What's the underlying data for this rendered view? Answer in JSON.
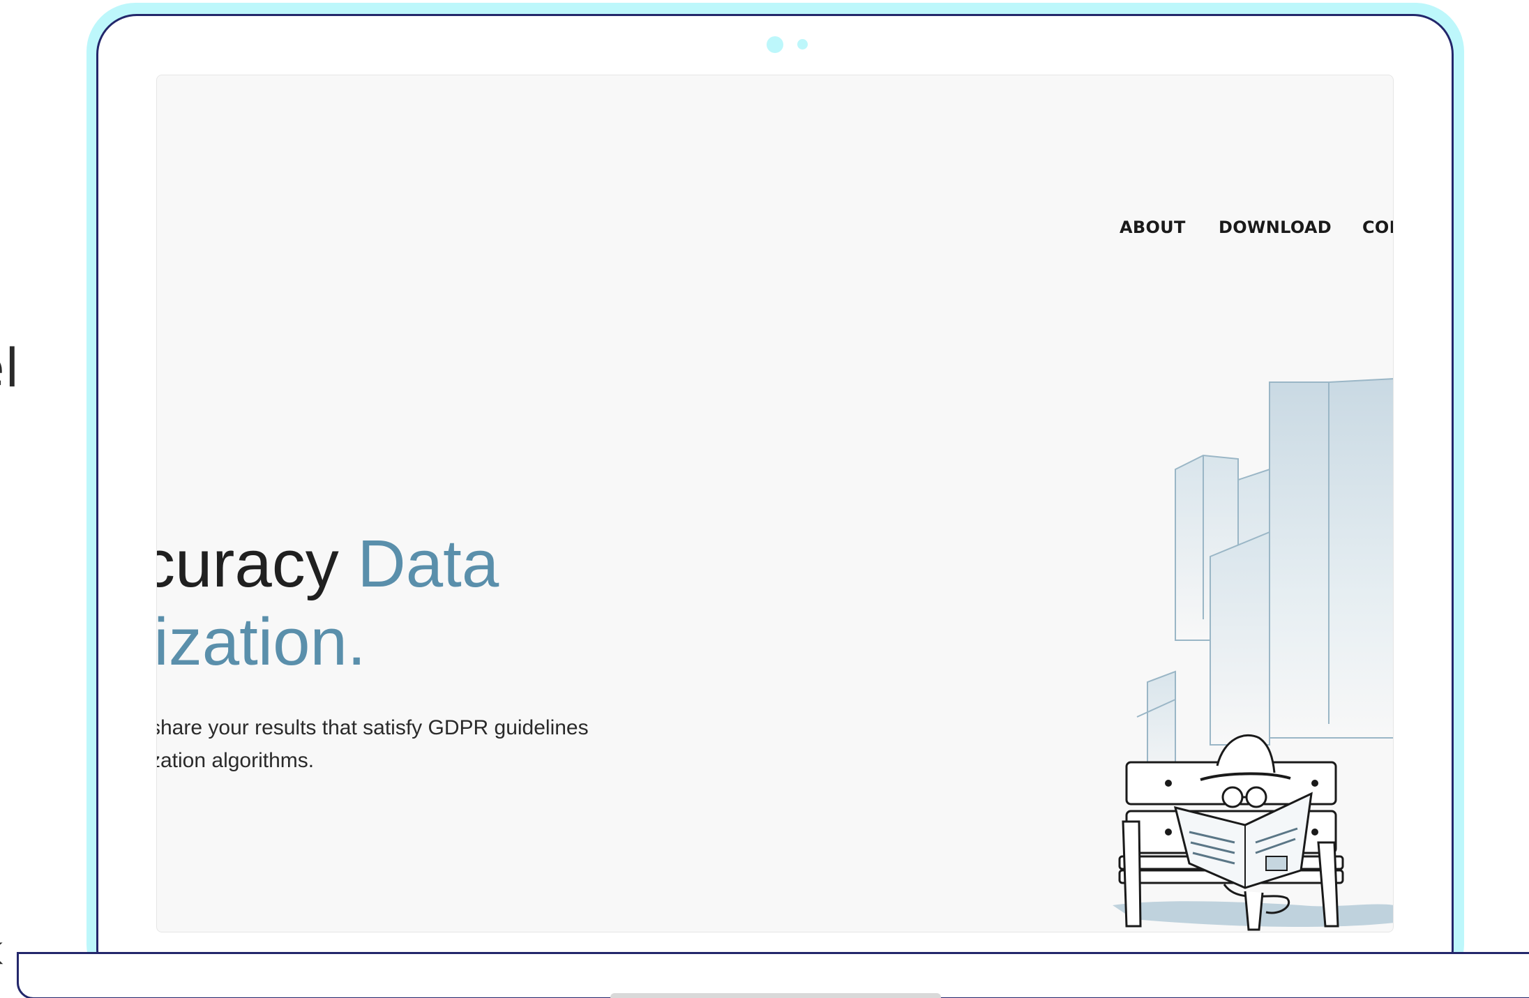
{
  "outside": {
    "line1": "el",
    "line2": "t",
    "line3": "k"
  },
  "nav": {
    "about": "ABOUT",
    "download": "DOWNLOAD",
    "contact": "CON"
  },
  "hero": {
    "title_part1": "ccuracy ",
    "title_accent1": "Data",
    "title_accent2": "nization.",
    "subtitle_line1": "share your results that satisfy GDPR guidelines",
    "subtitle_line2": "zation algorithms."
  },
  "colors": {
    "accent": "#5a8fab",
    "frame": "#23276b",
    "glow": "#bdf7fb",
    "screen_bg": "#f8f8f8"
  },
  "illustration": {
    "icon": "person-reading-newspaper-on-bench-illustration"
  }
}
